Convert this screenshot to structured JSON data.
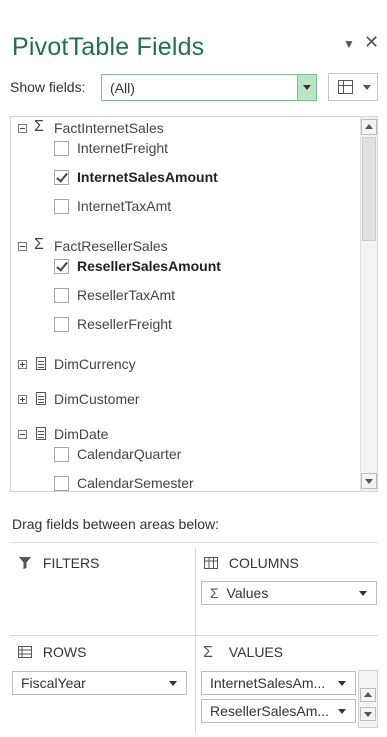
{
  "header": {
    "title": "PivotTable Fields",
    "menu_glyph": "▼",
    "close_glyph": "✕"
  },
  "show_fields": {
    "label": "Show fields:",
    "value": "(All)"
  },
  "field_list": {
    "tables": [
      {
        "name": "FactInternetSales",
        "icon": "sigma",
        "glyph": "Σ",
        "expanded": true,
        "fields": [
          {
            "name": "InternetFreight",
            "checked": false
          },
          {
            "name": "InternetSalesAmount",
            "checked": true
          },
          {
            "name": "InternetTaxAmt",
            "checked": false
          }
        ]
      },
      {
        "name": "FactResellerSales",
        "icon": "sigma",
        "glyph": "Σ",
        "expanded": true,
        "fields": [
          {
            "name": "ResellerSalesAmount",
            "checked": true
          },
          {
            "name": "ResellerTaxAmt",
            "checked": false
          },
          {
            "name": "ResellerFreight",
            "checked": false
          }
        ]
      },
      {
        "name": "DimCurrency",
        "icon": "table",
        "expanded": false,
        "fields": []
      },
      {
        "name": "DimCustomer",
        "icon": "table",
        "expanded": false,
        "fields": []
      },
      {
        "name": "DimDate",
        "icon": "table",
        "expanded": true,
        "fields": [
          {
            "name": "CalendarQuarter",
            "checked": false
          },
          {
            "name": "CalendarSemester",
            "checked": false
          }
        ]
      }
    ]
  },
  "areas": {
    "instruction": "Drag fields between areas below:",
    "filters": {
      "label": "FILTERS",
      "items": []
    },
    "columns": {
      "label": "COLUMNS",
      "items": [
        {
          "label": "Values",
          "prefix": "Σ"
        }
      ]
    },
    "rows": {
      "label": "ROWS",
      "items": [
        {
          "label": "FiscalYear"
        }
      ]
    },
    "values": {
      "label": "VALUES",
      "glyph": "Σ",
      "items": [
        {
          "label": "InternetSalesAm..."
        },
        {
          "label": "ResellerSalesAm..."
        }
      ]
    }
  },
  "colors": {
    "accent": "#217346",
    "dropdown_button": "#bde3c6"
  }
}
